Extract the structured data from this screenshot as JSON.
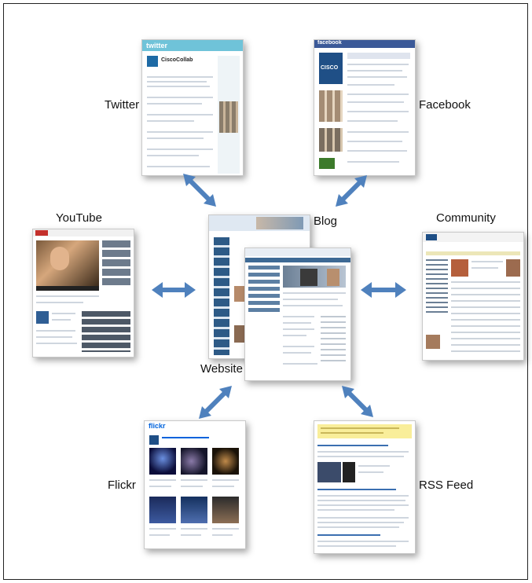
{
  "labels": {
    "twitter": "Twitter",
    "facebook": "Facebook",
    "youtube": "YouTube",
    "blog": "Blog",
    "community": "Community",
    "website": "Website",
    "flickr": "Flickr",
    "rss": "RSS Feed"
  },
  "thumbnails": {
    "twitter_brand": "twitter",
    "twitter_account": "CiscoCollab",
    "facebook_brand": "facebook",
    "facebook_logo": "CISCO",
    "flickr_brand": "flickr"
  },
  "colors": {
    "arrow": "#4f81bd",
    "twitter": "#6fc3d9",
    "facebook": "#3b5998",
    "youtube": "#c4302b",
    "flickr_blue": "#0063dc",
    "flickr_pink": "#ff0084",
    "rss": "#f9ee9a"
  }
}
